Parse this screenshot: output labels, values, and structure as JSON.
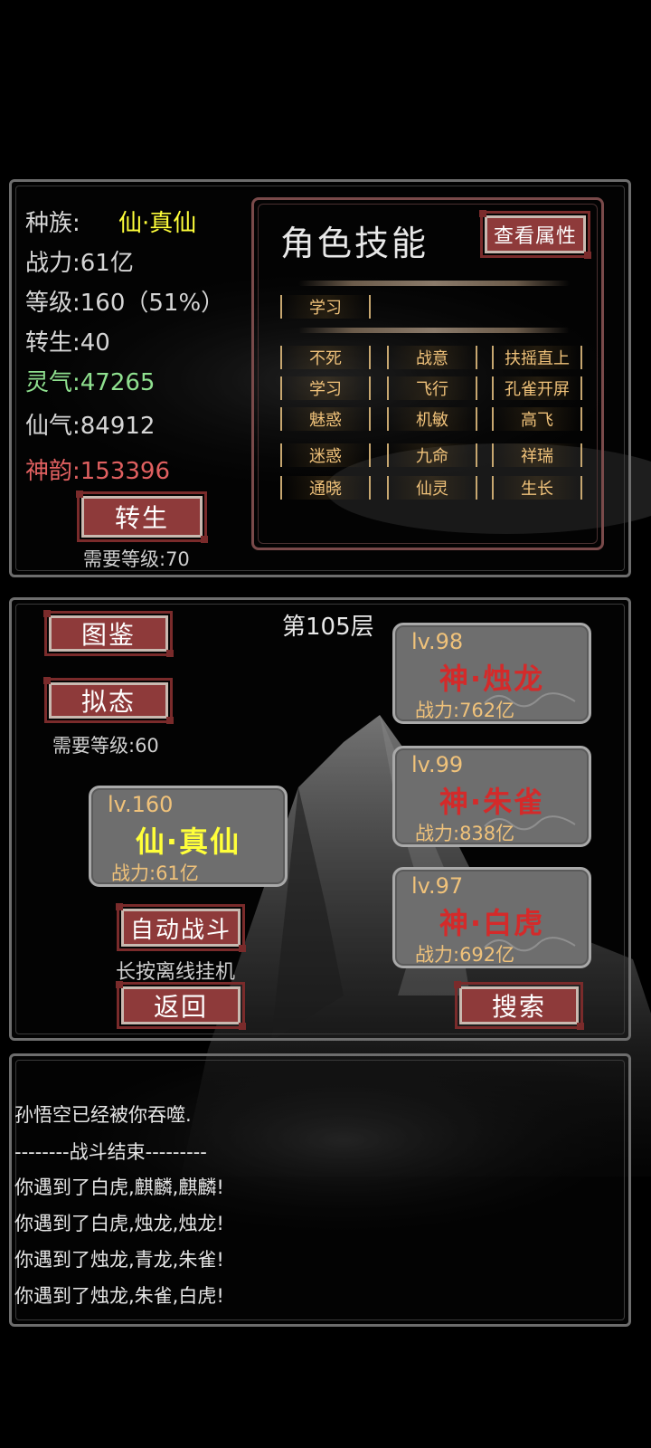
{
  "stats": {
    "race_label": "种族:",
    "race_value": "仙·真仙",
    "power": "战力:61亿",
    "level": "等级:160（51%）",
    "rebirth": "转生:40",
    "lingqi": "灵气:47265",
    "xianqi": "仙气:84912",
    "shenyun": "神韵:153396",
    "rebirth_button": "转生",
    "rebirth_req": "需要等级:70"
  },
  "skills": {
    "title": "角色技能",
    "view_attr_button": "查看属性",
    "learn_row": [
      "学习"
    ],
    "grid": [
      [
        "不死",
        "战意",
        "扶摇直上"
      ],
      [
        "学习",
        "飞行",
        "孔雀开屏"
      ],
      [
        "魅惑",
        "机敏",
        "高飞"
      ],
      [
        "迷惑",
        "九命",
        "祥瑞"
      ],
      [
        "通晓",
        "仙灵",
        "生长"
      ]
    ]
  },
  "battle": {
    "floor": "第105层",
    "atlas_button": "图鉴",
    "mimic_button": "拟态",
    "mimic_req": "需要等级:60",
    "auto_button": "自动战斗",
    "auto_hint": "长按离线挂机",
    "back_button": "返回",
    "search_button": "搜索",
    "player": {
      "lv": "lv.160",
      "name": "仙·真仙",
      "power": "战力:61亿"
    },
    "enemies": [
      {
        "lv": "lv.98",
        "name": "神·烛龙",
        "power": "战力:762亿"
      },
      {
        "lv": "lv.99",
        "name": "神·朱雀",
        "power": "战力:838亿"
      },
      {
        "lv": "lv.97",
        "name": "神·白虎",
        "power": "战力:692亿"
      }
    ]
  },
  "log": [
    "孙悟空已经被你吞噬.",
    "--------战斗结束---------",
    "你遇到了白虎,麒麟,麒麟!",
    "你遇到了白虎,烛龙,烛龙!",
    "你遇到了烛龙,青龙,朱雀!",
    "你遇到了烛龙,朱雀,白虎!"
  ],
  "colors": {
    "yellow": "#ffff3a",
    "green": "#8fe08f",
    "red": "#e06060",
    "gold": "#f0c27a",
    "button_red": "#8e3a3a",
    "enemy_name": "#d42a2a"
  }
}
